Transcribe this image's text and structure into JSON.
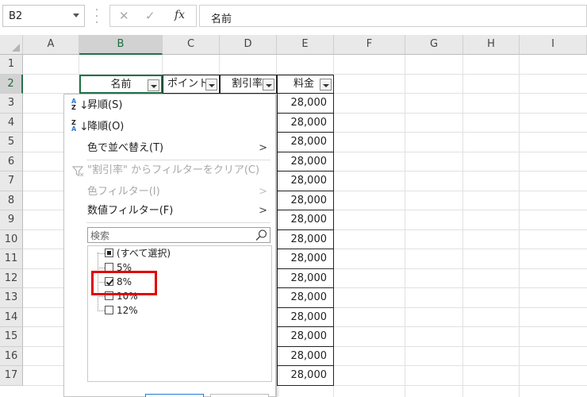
{
  "formula_bar": {
    "name_box": "B2",
    "cancel_icon": "✕",
    "enter_icon": "✓",
    "fx_label": "fx",
    "content": "名前"
  },
  "columns": [
    "A",
    "B",
    "C",
    "D",
    "E",
    "F",
    "G",
    "H",
    "I"
  ],
  "selected_column": "B",
  "rows": [
    "1",
    "2",
    "3",
    "4",
    "5",
    "6",
    "7",
    "8",
    "9",
    "10",
    "11",
    "12",
    "13",
    "14",
    "15",
    "16",
    "17"
  ],
  "selected_row": "2",
  "table_headers": {
    "name": "名前",
    "points": "ポイント",
    "discount": "割引率",
    "fee": "料金"
  },
  "fee_values": [
    "28,000",
    "28,000",
    "28,000",
    "28,000",
    "28,000",
    "28,000",
    "28,000",
    "28,000",
    "28,000",
    "28,000",
    "28,000",
    "28,000",
    "28,000",
    "28,000",
    "28,000"
  ],
  "filter_menu": {
    "sort_asc": "昇順(S)",
    "sort_desc": "降順(O)",
    "sort_by_color": "色で並べ替え(T)",
    "clear_filter": "\"割引率\" からフィルターをクリア(C)",
    "color_filter": "色フィルター(I)",
    "number_filter": "数値フィルター(F)",
    "search_placeholder": "検索",
    "items": [
      {
        "label": "(すべて選択)",
        "state": "partial"
      },
      {
        "label": "5%",
        "state": "unchecked"
      },
      {
        "label": "8%",
        "state": "checked"
      },
      {
        "label": "10%",
        "state": "unchecked"
      },
      {
        "label": "12%",
        "state": "unchecked"
      }
    ]
  },
  "colors": {
    "accent_green": "#217346",
    "highlight_red": "#e20000"
  }
}
